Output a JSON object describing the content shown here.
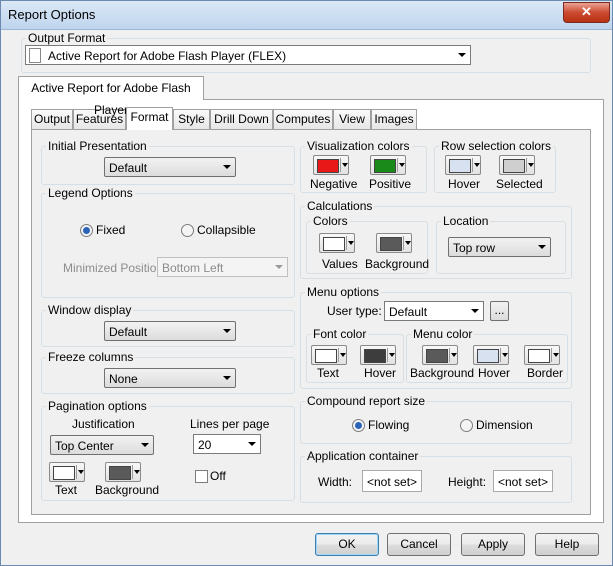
{
  "window": {
    "title": "Report Options",
    "close_glyph": "✕"
  },
  "output_format": {
    "legend": "Output Format",
    "value": "Active Report for Adobe Flash Player (FLEX)"
  },
  "outer_tab": {
    "label": "Active Report for Adobe Flash Player"
  },
  "tabs": [
    "Output",
    "Features",
    "Format",
    "Style",
    "Drill Down",
    "Computes",
    "View",
    "Images"
  ],
  "selected_tab": "Format",
  "initial_presentation": {
    "legend": "Initial Presentation",
    "value": "Default"
  },
  "legend_options": {
    "legend": "Legend Options",
    "fixed_label": "Fixed",
    "collapsible_label": "Collapsible",
    "selected": "Fixed",
    "minimized_label": "Minimized Position:",
    "minimized_value": "Bottom Left"
  },
  "window_display": {
    "legend": "Window display",
    "value": "Default"
  },
  "freeze_columns": {
    "legend": "Freeze columns",
    "value": "None"
  },
  "pagination": {
    "legend": "Pagination options",
    "justification_label": "Justification",
    "justification_value": "Top Center",
    "lines_label": "Lines per page",
    "lines_value": "20",
    "off_label": "Off",
    "off_checked": false,
    "text_label": "Text",
    "background_label": "Background",
    "text_color": "#ffffff",
    "background_color": "#5a5a5a"
  },
  "visualization_colors": {
    "legend": "Visualization colors",
    "negative_label": "Negative",
    "positive_label": "Positive",
    "negative_color": "#e81818",
    "positive_color": "#1a8a1a"
  },
  "row_selection_colors": {
    "legend": "Row selection colors",
    "hover_label": "Hover",
    "selected_label": "Selected",
    "hover_color": "#d7e1ef",
    "selected_color": "#cfcfcf"
  },
  "calculations": {
    "legend": "Calculations",
    "colors_legend": "Colors",
    "values_label": "Values",
    "background_label": "Background",
    "values_color": "#ffffff",
    "background_color": "#5a5a5a",
    "location_legend": "Location",
    "location_value": "Top row"
  },
  "menu_options": {
    "legend": "Menu options",
    "user_type_label": "User type:",
    "user_type_value": "Default",
    "browse_label": "...",
    "font_color_legend": "Font color",
    "menu_color_legend": "Menu color",
    "text_label": "Text",
    "hover_label": "Hover",
    "background_label": "Background",
    "hover2_label": "Hover",
    "border_label": "Border",
    "font_text_color": "#ffffff",
    "font_hover_color": "#3d3d3d",
    "menu_background_color": "#5a5a5a",
    "menu_hover_color": "#d7e1ef",
    "menu_border_color": "#ffffff"
  },
  "compound_report": {
    "legend": "Compound report size",
    "flowing_label": "Flowing",
    "dimension_label": "Dimension",
    "selected": "Flowing"
  },
  "application_container": {
    "legend": "Application container",
    "width_label": "Width:",
    "width_value": "<not set>",
    "height_label": "Height:",
    "height_value": "<not set>"
  },
  "buttons": {
    "ok": "OK",
    "cancel": "Cancel",
    "apply": "Apply",
    "help": "Help"
  }
}
